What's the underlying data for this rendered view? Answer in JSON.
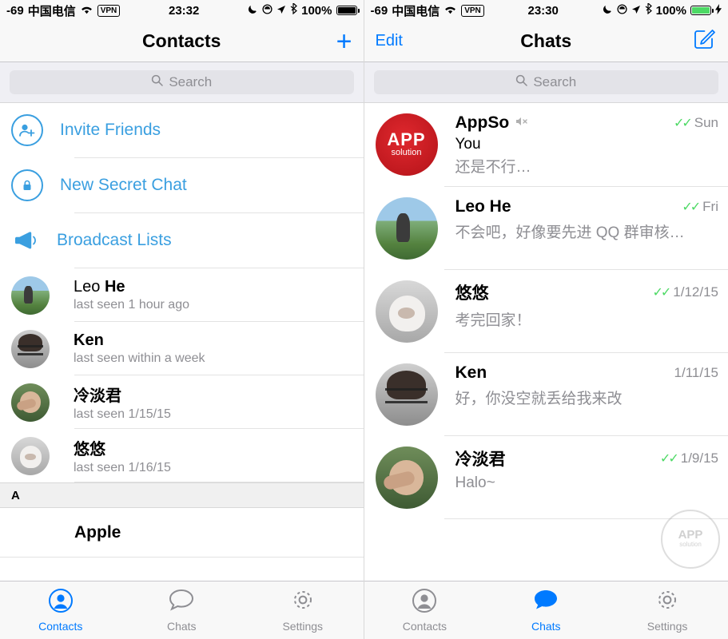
{
  "left": {
    "status": {
      "carrier_signal": "-69",
      "carrier": "中国电信",
      "wifi_icon": "wifi-icon",
      "vpn": "VPN",
      "time": "23:32",
      "moon_icon": "moon-icon",
      "dnd_icon": "do-not-disturb-icon",
      "location_icon": "location-arrow-icon",
      "bluetooth_icon": "bluetooth-icon",
      "battery_percent": "100%",
      "battery_icon": "battery-full-icon"
    },
    "nav": {
      "title": "Contacts",
      "add_label": "+"
    },
    "search": {
      "placeholder": "Search",
      "icon": "search-icon"
    },
    "actions": [
      {
        "label": "Invite Friends",
        "icon": "add-person-icon"
      },
      {
        "label": "New Secret Chat",
        "icon": "lock-icon"
      },
      {
        "label": "Broadcast Lists",
        "icon": "megaphone-icon"
      }
    ],
    "contacts": [
      {
        "first": "Leo",
        "last": "He",
        "status": "last seen 1 hour ago",
        "avatar": "av-leo"
      },
      {
        "first": "Ken",
        "last": "",
        "status": "last seen within a week",
        "avatar": "av-ken"
      },
      {
        "first": "冷淡君",
        "last": "",
        "status": "last seen 1/15/15",
        "avatar": "av-leng"
      },
      {
        "first": "悠悠",
        "last": "",
        "status": "last seen 1/16/15",
        "avatar": "av-you"
      }
    ],
    "section_header": "A",
    "section_rows": [
      {
        "name": "Apple"
      }
    ],
    "tabs": [
      {
        "label": "Contacts",
        "icon": "person-icon",
        "active": true
      },
      {
        "label": "Chats",
        "icon": "chat-bubble-icon",
        "active": false
      },
      {
        "label": "Settings",
        "icon": "gear-icon",
        "active": false
      }
    ]
  },
  "right": {
    "status": {
      "carrier_signal": "-69",
      "carrier": "中国电信",
      "wifi_icon": "wifi-icon",
      "vpn": "VPN",
      "time": "23:30",
      "moon_icon": "moon-icon",
      "dnd_icon": "do-not-disturb-icon",
      "location_icon": "location-arrow-icon",
      "bluetooth_icon": "bluetooth-icon",
      "battery_percent": "100%",
      "battery_icon": "battery-charging-icon"
    },
    "nav": {
      "left_label": "Edit",
      "title": "Chats",
      "compose_icon": "compose-icon"
    },
    "search": {
      "placeholder": "Search",
      "icon": "search-icon"
    },
    "chats": [
      {
        "name": "AppSo",
        "muted": true,
        "mute_icon": "mute-icon",
        "ticks": "✓✓",
        "time": "Sun",
        "line1": "You",
        "line2": "还是不行…",
        "avatar": "av-appso"
      },
      {
        "name": "Leo He",
        "muted": false,
        "ticks": "✓✓",
        "time": "Fri",
        "snippet": "不会吧，好像要先进 QQ 群审核…",
        "avatar": "av-leo"
      },
      {
        "name": "悠悠",
        "muted": false,
        "ticks": "✓✓",
        "time": "1/12/15",
        "snippet": "考完回家！",
        "avatar": "av-you"
      },
      {
        "name": "Ken",
        "muted": false,
        "ticks": "",
        "time": "1/11/15",
        "snippet": "好，你没空就丢给我来改",
        "avatar": "av-ken"
      },
      {
        "name": "冷淡君",
        "muted": false,
        "ticks": "✓✓",
        "time": "1/9/15",
        "snippet": "Halo~",
        "avatar": "av-leng"
      }
    ],
    "watermark": {
      "line1": "APP",
      "line2": "solution"
    },
    "tabs": [
      {
        "label": "Contacts",
        "icon": "person-icon",
        "active": false
      },
      {
        "label": "Chats",
        "icon": "chat-bubble-icon",
        "active": true
      },
      {
        "label": "Settings",
        "icon": "gear-icon",
        "active": false
      }
    ]
  }
}
